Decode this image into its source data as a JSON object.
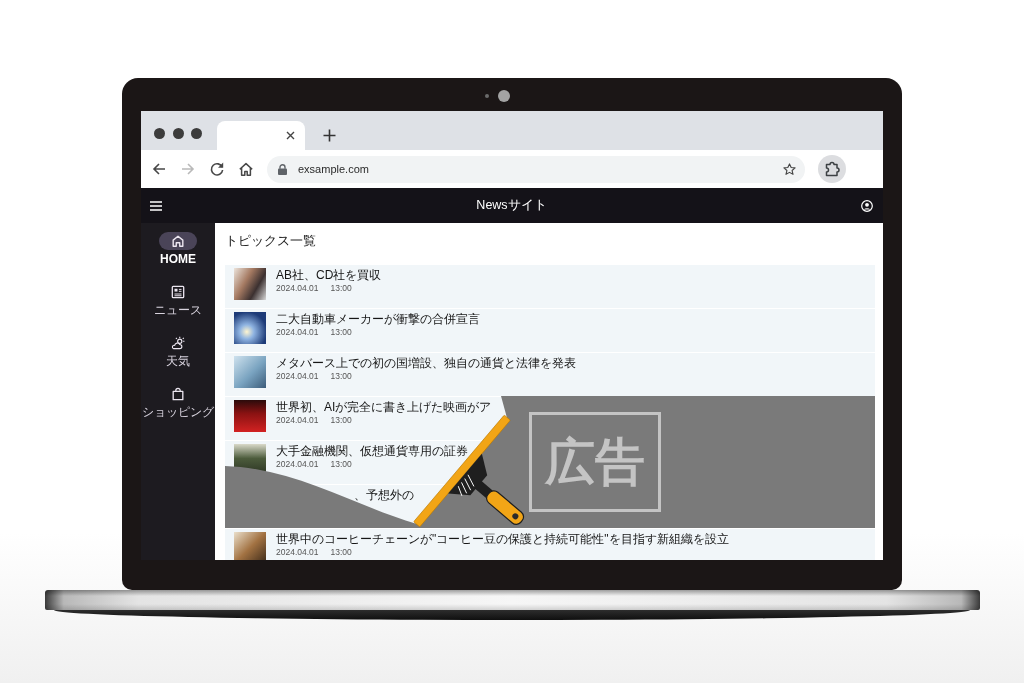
{
  "browser": {
    "tabs": [
      {
        "selected": true
      }
    ],
    "nav_buttons": [
      {
        "disabled": false
      },
      {
        "disabled": true
      },
      {
        "disabled": false
      },
      {
        "disabled": false
      }
    ],
    "address": "exsample.com"
  },
  "app_header": {
    "title": "Newsサイト"
  },
  "sidebar": {
    "items": [
      {
        "label": "HOME",
        "selected": true
      },
      {
        "label": "ニュース",
        "selected": false
      },
      {
        "label": "天気",
        "selected": false
      },
      {
        "label": "ショッピング",
        "selected": false
      }
    ]
  },
  "main": {
    "heading": "トピックス一覧",
    "articles": [
      {
        "kind": "full",
        "title": "AB社、CD社を買収",
        "date": "2024.04.01",
        "time": "13:00"
      },
      {
        "kind": "full",
        "title": "二大自動車メーカーが衝撃の合併宣言",
        "date": "2024.04.01",
        "time": "13:00"
      },
      {
        "kind": "full",
        "title": "メタバース上での初の国増設、独自の通貨と法律を発表",
        "date": "2024.04.01",
        "time": "13:00"
      },
      {
        "kind": "full",
        "title": "世界初、AIが完全に書き上げた映画がア",
        "date": "2024.04.01",
        "time": "13:00"
      },
      {
        "kind": "full",
        "title": "大手金融機関、仮想通貨専用の証券",
        "date": "2024.04.01",
        "time": "13:00"
      },
      {
        "kind": "covered",
        "title": "、予想外の"
      },
      {
        "kind": "full",
        "title": "世界中のコーヒーチェーンが\"コーヒー豆の保護と持続可能性\"を目指す新組織を設立",
        "date": "2024.04.01",
        "time": "13:00"
      }
    ]
  },
  "ad": {
    "label": "広告"
  }
}
